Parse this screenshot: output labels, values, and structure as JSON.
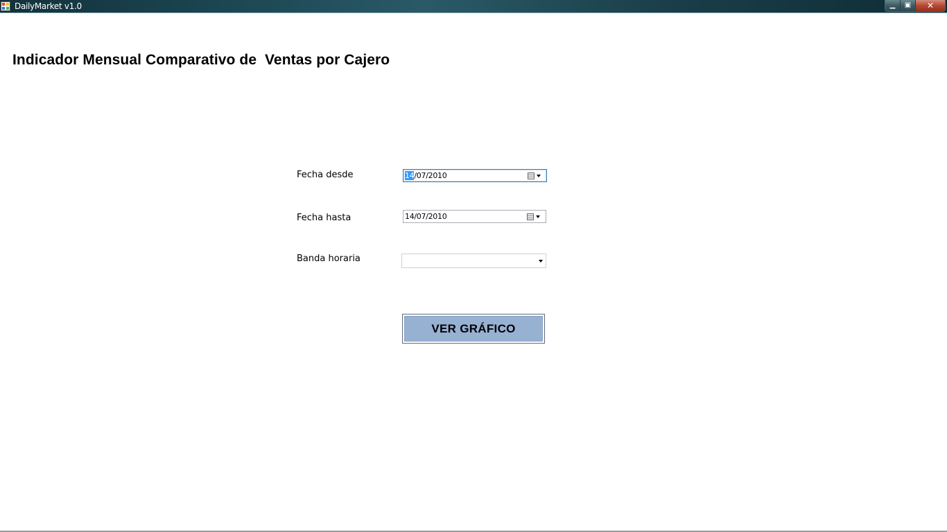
{
  "window": {
    "title": "DailyMarket v1.0",
    "controls": {
      "minimize_glyph": "▁",
      "restore_glyph": "▣",
      "close_glyph": "✕"
    }
  },
  "form": {
    "heading": "Indicador Mensual Comparativo de  Ventas por Cajero",
    "fecha_desde": {
      "label": "Fecha desde",
      "value_day": "14",
      "value_rest": "/07/2010"
    },
    "fecha_hasta": {
      "label": "Fecha hasta",
      "value": "14/07/2010"
    },
    "banda_horaria": {
      "label": "Banda horaria",
      "value": ""
    },
    "submit_label": "VER GRÁFICO"
  },
  "colors": {
    "titlebar": "#1c4753",
    "button_fill": "#97b1d3",
    "selection": "#3399ff"
  },
  "icons": [
    "app-icon",
    "calendar-icon",
    "chevron-down-icon"
  ]
}
